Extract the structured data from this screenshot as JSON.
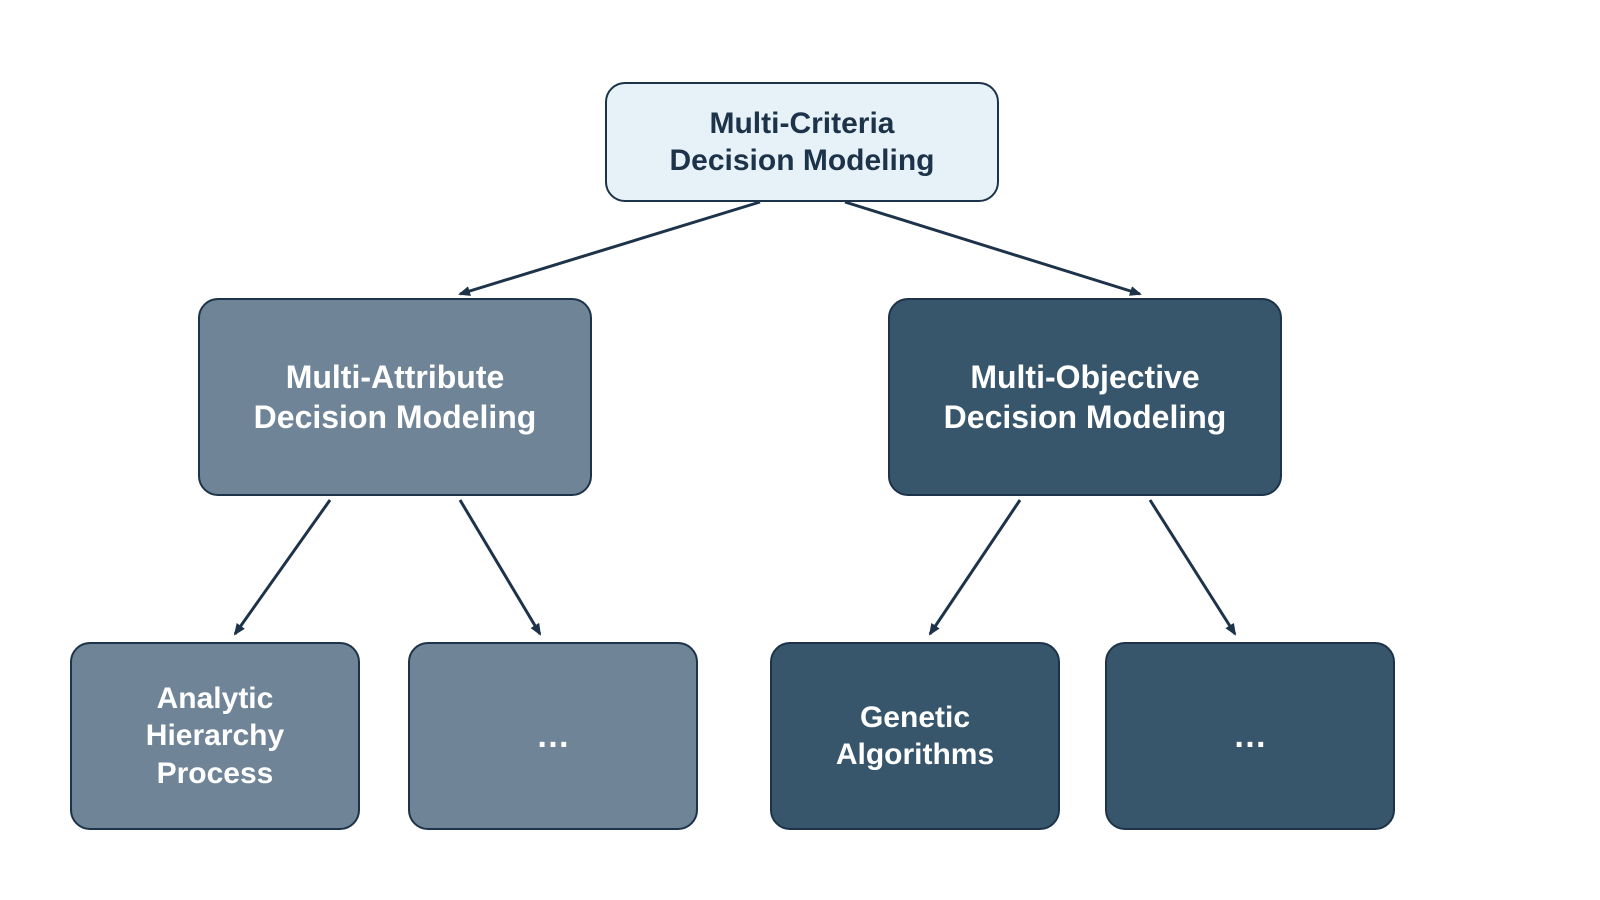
{
  "colors": {
    "root_bg": "#e6f2f7",
    "root_text": "#1d3349",
    "border": "#1d3349",
    "branch_a_bg": "#6f8597",
    "branch_b_bg": "#37566b",
    "leaf_text": "#ffffff",
    "arrow": "#1d3349"
  },
  "nodes": {
    "root": {
      "line1": "Multi-Criteria",
      "line2": "Decision Modeling"
    },
    "left": {
      "line1": "Multi-Attribute",
      "line2": "Decision Modeling"
    },
    "right": {
      "line1": "Multi-Objective",
      "line2": "Decision Modeling"
    },
    "left_child_1": {
      "line1": "Analytic",
      "line2": "Hierarchy",
      "line3": "Process"
    },
    "left_child_2": {
      "label": "…"
    },
    "right_child_1": {
      "line1": "Genetic",
      "line2": "Algorithms"
    },
    "right_child_2": {
      "label": "…"
    }
  }
}
